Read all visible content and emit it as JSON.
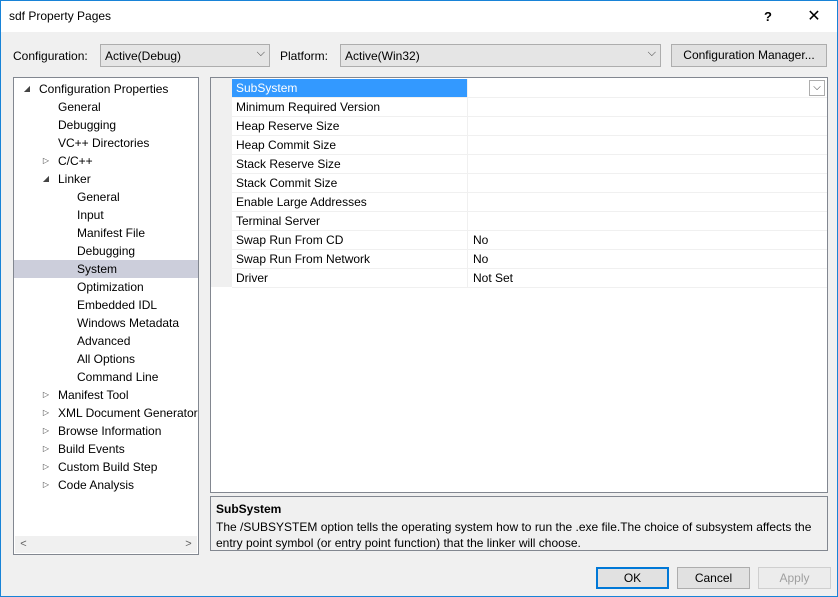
{
  "window": {
    "title": "sdf Property Pages",
    "help_glyph": "?",
    "close_glyph": "✕"
  },
  "toolbar": {
    "configuration_label": "Configuration:",
    "configuration_value": "Active(Debug)",
    "platform_label": "Platform:",
    "platform_value": "Active(Win32)",
    "config_manager_label": "Configuration Manager..."
  },
  "tree": {
    "items": [
      {
        "label": "Configuration Properties",
        "exp": "◢"
      },
      {
        "label": "General",
        "exp": ""
      },
      {
        "label": "Debugging",
        "exp": ""
      },
      {
        "label": "VC++ Directories",
        "exp": ""
      },
      {
        "label": "C/C++",
        "exp": "▷"
      },
      {
        "label": "Linker",
        "exp": "◢"
      },
      {
        "label": "General",
        "exp": ""
      },
      {
        "label": "Input",
        "exp": ""
      },
      {
        "label": "Manifest File",
        "exp": ""
      },
      {
        "label": "Debugging",
        "exp": ""
      },
      {
        "label": "System",
        "exp": ""
      },
      {
        "label": "Optimization",
        "exp": ""
      },
      {
        "label": "Embedded IDL",
        "exp": ""
      },
      {
        "label": "Windows Metadata",
        "exp": ""
      },
      {
        "label": "Advanced",
        "exp": ""
      },
      {
        "label": "All Options",
        "exp": ""
      },
      {
        "label": "Command Line",
        "exp": ""
      },
      {
        "label": "Manifest Tool",
        "exp": "▷"
      },
      {
        "label": "XML Document Generator",
        "exp": "▷"
      },
      {
        "label": "Browse Information",
        "exp": "▷"
      },
      {
        "label": "Build Events",
        "exp": "▷"
      },
      {
        "label": "Custom Build Step",
        "exp": "▷"
      },
      {
        "label": "Code Analysis",
        "exp": "▷"
      }
    ],
    "selected_label": "System",
    "scroll_left_glyph": "<",
    "scroll_right_glyph": ">"
  },
  "properties": [
    {
      "name": "SubSystem",
      "value": ""
    },
    {
      "name": "Minimum Required Version",
      "value": ""
    },
    {
      "name": "Heap Reserve Size",
      "value": ""
    },
    {
      "name": "Heap Commit Size",
      "value": ""
    },
    {
      "name": "Stack Reserve Size",
      "value": ""
    },
    {
      "name": "Stack Commit Size",
      "value": ""
    },
    {
      "name": "Enable Large Addresses",
      "value": ""
    },
    {
      "name": "Terminal Server",
      "value": ""
    },
    {
      "name": "Swap Run From CD",
      "value": "No"
    },
    {
      "name": "Swap Run From Network",
      "value": "No"
    },
    {
      "name": "Driver",
      "value": "Not Set"
    }
  ],
  "description": {
    "title": "SubSystem",
    "text": "The /SUBSYSTEM option tells the operating system how to run the .exe file.The choice of subsystem affects the entry point symbol (or entry point function) that the linker will choose."
  },
  "buttons": {
    "ok": "OK",
    "cancel": "Cancel",
    "apply": "Apply"
  },
  "colors": {
    "selection": "#3399ff",
    "tree_selection": "#cccedb",
    "window_border": "#1883d7",
    "ok_border": "#0078d7"
  }
}
